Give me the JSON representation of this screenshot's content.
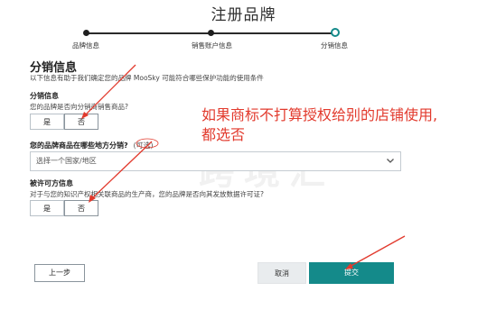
{
  "page_title": "注册品牌",
  "progress": {
    "steps": [
      {
        "label": "品牌信息",
        "state": "done"
      },
      {
        "label": "销售账户信息",
        "state": "done"
      },
      {
        "label": "分销信息",
        "state": "current"
      }
    ]
  },
  "section": {
    "title": "分销信息",
    "description": "以下信息有助于我们确定您的品牌 MooSky 可能符合哪些保护功能的使用条件"
  },
  "q1": {
    "title": "分销信息",
    "description": "您的品牌是否向分销商销售商品?",
    "options": [
      "是",
      "否"
    ],
    "selected": "否"
  },
  "q2": {
    "title": "您的品牌商品在哪些地方分销?",
    "optional": "(可选)",
    "placeholder": "选择一个国家/地区"
  },
  "q3": {
    "title": "被许可方信息",
    "description": "对于与您的知识产权相关联商品的生产商，您的品牌是否向其发放数据许可证?",
    "options": [
      "是",
      "否"
    ],
    "selected": "否"
  },
  "buttons": {
    "back": "上一步",
    "cancel": "取消",
    "submit": "提交"
  },
  "annotation": {
    "line1": "如果商标不打算授权给别的店铺使用,",
    "line2": "都选否"
  },
  "watermark": "跨境汇",
  "colors": {
    "accent": "#148a8a",
    "annotation_red": "#e23a2d"
  }
}
